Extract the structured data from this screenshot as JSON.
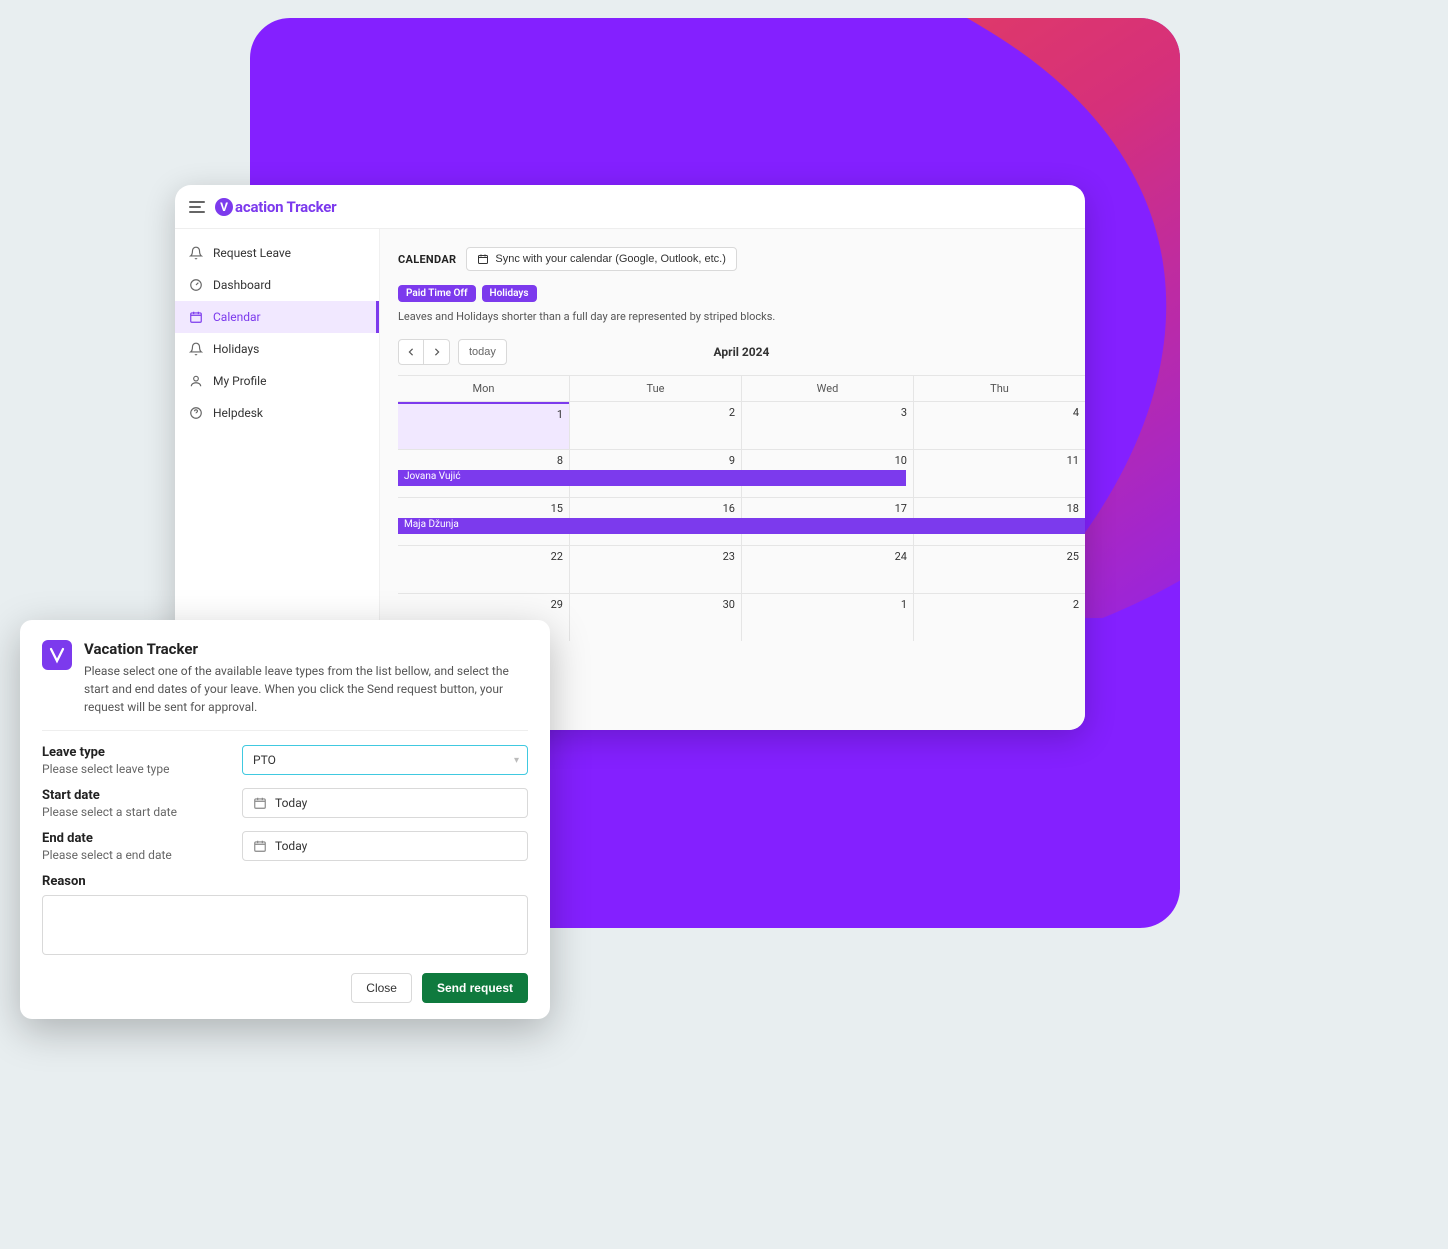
{
  "app": {
    "name": "acation Tracker",
    "logo_letter": "V"
  },
  "sidebar": {
    "items": [
      {
        "label": "Request Leave",
        "icon": "bell"
      },
      {
        "label": "Dashboard",
        "icon": "gauge"
      },
      {
        "label": "Calendar",
        "icon": "calendar",
        "active": true
      },
      {
        "label": "Holidays",
        "icon": "bell"
      },
      {
        "label": "My Profile",
        "icon": "user"
      },
      {
        "label": "Helpdesk",
        "icon": "help"
      }
    ]
  },
  "calendar": {
    "heading": "CALENDAR",
    "sync_label": "Sync with your calendar (Google, Outlook, etc.)",
    "pills": [
      "Paid Time Off",
      "Holidays"
    ],
    "note": "Leaves and Holidays shorter than a full day are represented by striped blocks.",
    "today_label": "today",
    "month": "April 2024",
    "day_headers": [
      "Mon",
      "Tue",
      "Wed",
      "Thu"
    ],
    "weeks": [
      [
        "1",
        "2",
        "3",
        "4"
      ],
      [
        "8",
        "9",
        "10",
        "11"
      ],
      [
        "15",
        "16",
        "17",
        "18"
      ],
      [
        "22",
        "23",
        "24",
        "25"
      ],
      [
        "29",
        "30",
        "1",
        "2"
      ]
    ],
    "events": [
      {
        "week": 1,
        "label": "Jovana Vujić",
        "span_pct": 74
      },
      {
        "week": 2,
        "label": "Maja Džunja",
        "span_pct": 100
      }
    ]
  },
  "modal": {
    "title": "Vacation Tracker",
    "description": "Please select one of the available leave types from the list bellow, and select the start and end dates of your leave. When you click the Send request button, your request will be sent for approval.",
    "leave_type_label": "Leave type",
    "leave_type_sub": "Please select leave type",
    "leave_type_value": "PTO",
    "start_label": "Start date",
    "start_sub": "Please select a start date",
    "start_value": "Today",
    "end_label": "End date",
    "end_sub": "Please select a end date",
    "end_value": "Today",
    "reason_label": "Reason",
    "close_label": "Close",
    "send_label": "Send request"
  }
}
